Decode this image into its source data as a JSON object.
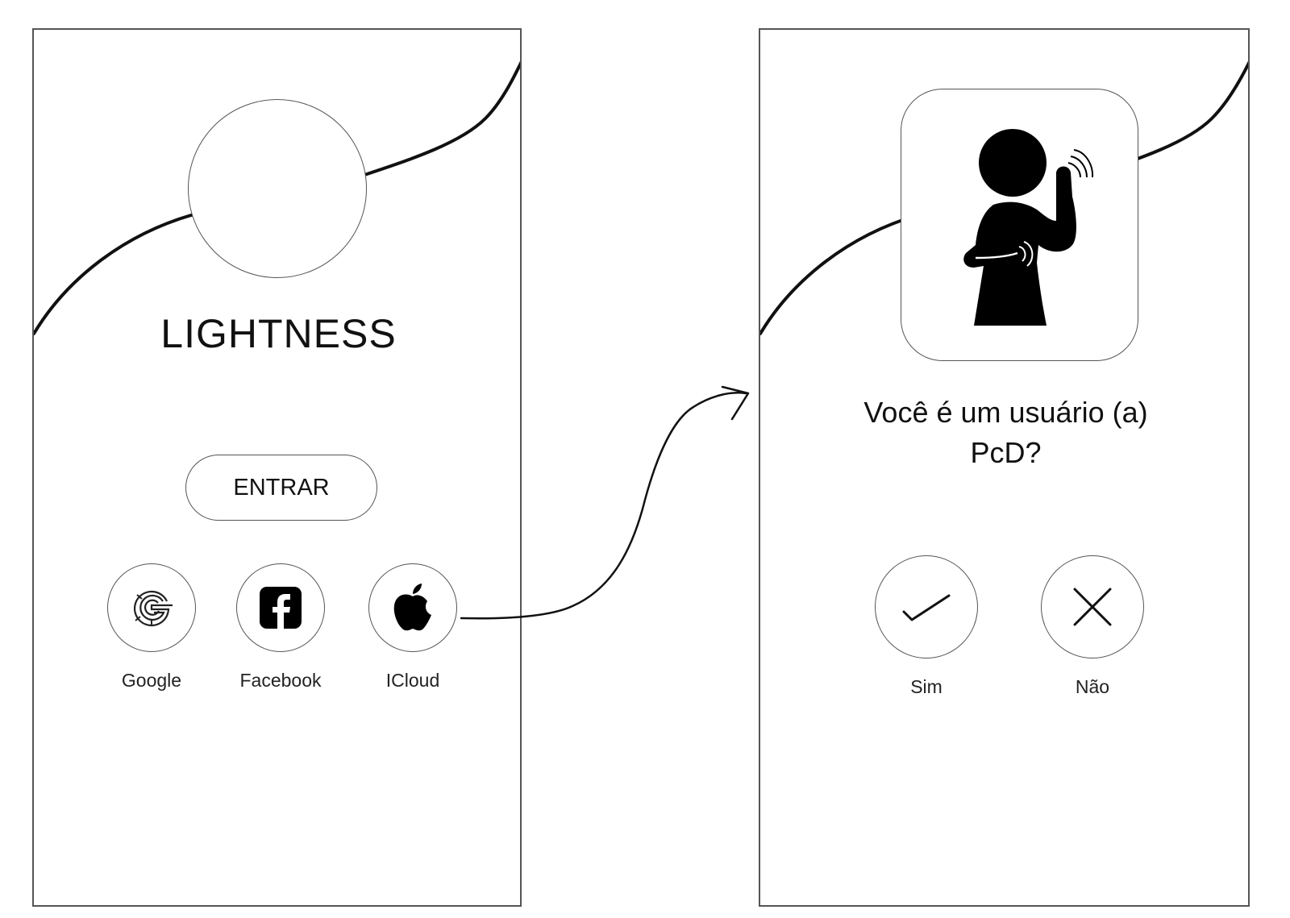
{
  "login_screen": {
    "app_title": "LIGHTNESS",
    "enter_button": "ENTRAR",
    "social_logins": [
      {
        "label": "Google",
        "icon": "google-icon"
      },
      {
        "label": "Facebook",
        "icon": "facebook-icon"
      },
      {
        "label": "ICloud",
        "icon": "apple-icon"
      }
    ]
  },
  "pcd_screen": {
    "illustration": "sign-language-person-icon",
    "question_line1": "Você é um usuário (a)",
    "question_line2": "PcD?",
    "answers": [
      {
        "label": "Sim",
        "icon": "check-icon"
      },
      {
        "label": "Não",
        "icon": "close-icon"
      }
    ]
  },
  "colors": {
    "line": "#111111",
    "border": "#555555",
    "background": "#ffffff"
  }
}
